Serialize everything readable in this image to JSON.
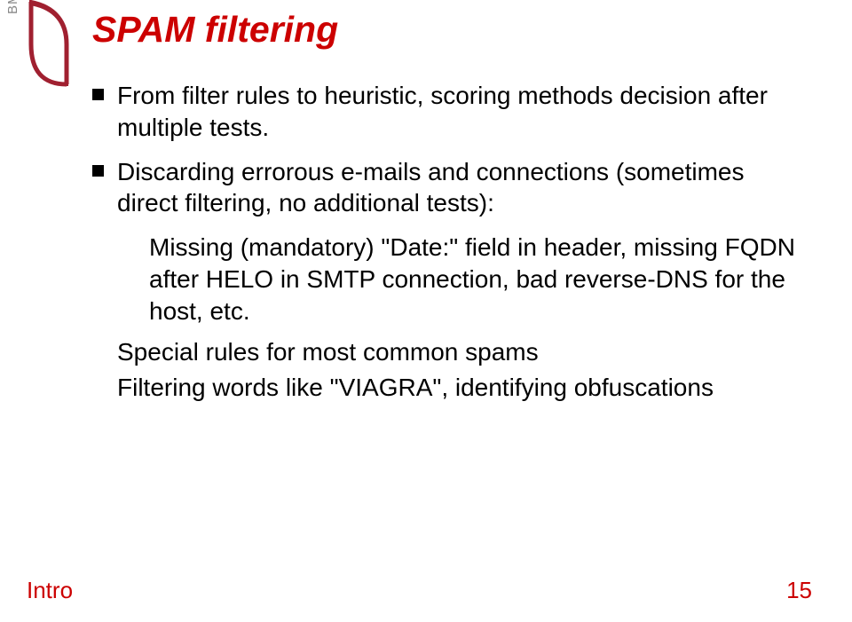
{
  "logo": {
    "text": "BME"
  },
  "title": "SPAM filtering",
  "bullets": {
    "b1": "From filter rules to heuristic, scoring methods decision after multiple tests.",
    "b2": "Discarding errorous e-mails and connections (sometimes direct filtering, no additional tests):",
    "b2_sub": "Missing (mandatory) \"Date:\" field in header, missing FQDN after HELO in SMTP connection, bad reverse-DNS for the host, etc.",
    "p1": "Special rules for most common spams",
    "p2": "Filtering words like \"VIAGRA\", identifying obfuscations"
  },
  "footer": {
    "left": "Intro",
    "right": "15"
  }
}
